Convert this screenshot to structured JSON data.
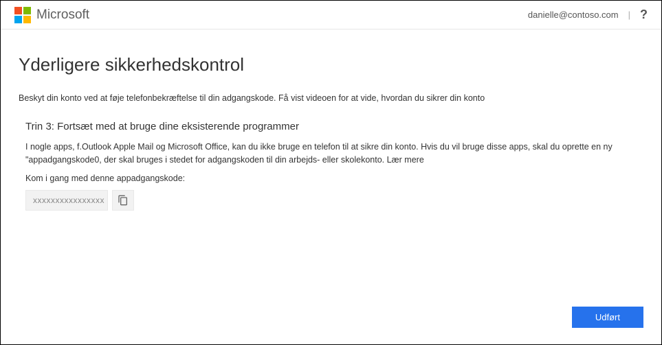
{
  "header": {
    "brand": "Microsoft",
    "user_email": "danielle@contoso.com",
    "divider": "|",
    "help": "?"
  },
  "page": {
    "title": "Yderligere sikkerhedskontrol",
    "subtitle": "Beskyt din konto ved at føje telefonbekræftelse til din adgangskode. Få vist videoen for at vide, hvordan du sikrer din konto"
  },
  "step": {
    "heading": "Trin 3: Fortsæt med at bruge dine eksisterende programmer",
    "body": "I nogle apps, f.Outlook Apple Mail og Microsoft Office, kan du ikke bruge en telefon til at sikre din konto. Hvis du vil bruge disse apps, skal du oprette en ny \"appadgangskode0, der skal bruges i stedet for adgangskoden til din arbejds- eller skolekonto. Lær mere",
    "getstarted": "Kom i gang med denne appadgangskode:",
    "password_masked": "xxxxxxxxxxxxxxxx"
  },
  "actions": {
    "done": "Udført"
  }
}
